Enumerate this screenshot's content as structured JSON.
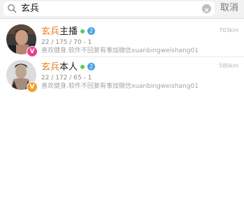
{
  "search": {
    "query": "玄兵",
    "cancel_label": "取消"
  },
  "results": [
    {
      "name_highlight": "玄兵",
      "name_rest": "主播",
      "level": "2",
      "distance": "703km",
      "stats": "22 / 175 / 70 - 1",
      "bio": "喜欢健身.软件不回复有事加微信xuanbingweishang01",
      "badge_letter": "V",
      "badge_color": "#e8428a"
    },
    {
      "name_highlight": "玄兵",
      "name_rest": "本人",
      "level": "2",
      "distance": "580km",
      "stats": "22 / 172 / 65 - 1",
      "bio": "喜欢健身.软件不回复有事加微信xuanbingweishang01",
      "badge_letter": "V",
      "badge_color": "#f2a22a"
    }
  ],
  "colors": {
    "highlight": "#f07a1b",
    "online": "#5ec85e",
    "level": "#4aa3e3"
  }
}
